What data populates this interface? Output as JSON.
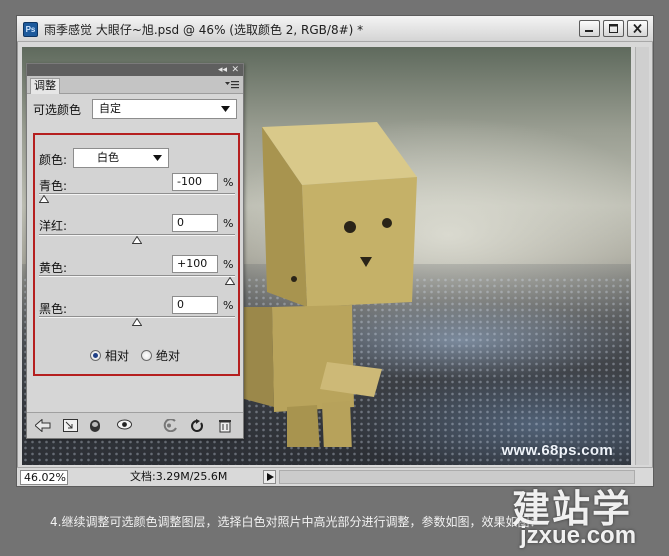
{
  "window": {
    "title": "雨季感觉  大眼仔~旭.psd @ 46% (选取颜色 2, RGB/8#) *",
    "app_icon": "Ps"
  },
  "status_bar": {
    "zoom": "46.02%",
    "doc_info": "文档:3.29M/25.6M"
  },
  "canvas": {
    "watermark": "www.68ps.com"
  },
  "panel": {
    "tab_label": "调整",
    "title": "可选颜色",
    "preset_value": "自定",
    "colors_label": "颜色:",
    "colors_value": "白色",
    "sliders": [
      {
        "label": "青色:",
        "value": "-100",
        "unit": "%",
        "level": -100
      },
      {
        "label": "洋红:",
        "value": "0",
        "unit": "%",
        "level": 0
      },
      {
        "label": "黄色:",
        "value": "+100",
        "unit": "%",
        "level": 100
      },
      {
        "label": "黑色:",
        "value": "0",
        "unit": "%",
        "level": 0
      }
    ],
    "method": {
      "relative_label": "相对",
      "absolute_label": "绝对",
      "selected": "relative"
    },
    "accent_color": "#b51f1f"
  },
  "caption": "4.继续调整可选颜色调整图层，选择白色对照片中高光部分进行调整，参数如图，效果如图：",
  "site_watermark": {
    "cn": "建站学",
    "en": "jzxue.com"
  }
}
